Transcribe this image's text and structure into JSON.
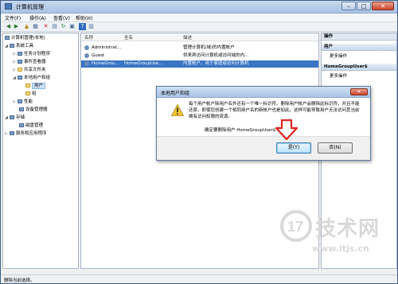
{
  "window": {
    "title": "计算机管理",
    "min": "–",
    "max": "□",
    "close": "✕"
  },
  "menu": [
    "文件(F)",
    "操作(A)",
    "查看(V)",
    "帮助(H)"
  ],
  "toolbar": {
    "icons": [
      "back-icon",
      "forward-icon",
      "up-icon",
      "show-tree-icon",
      "delete-icon",
      "properties-icon",
      "refresh-icon",
      "export-icon",
      "help-icon",
      "help-topics-icon"
    ]
  },
  "tree": {
    "root": "计算机管理(本地)",
    "system_tools": "系统工具",
    "task_scheduler": "任务计划程序",
    "event_viewer": "事件查看器",
    "shared_folders": "共享文件夹",
    "local_users_groups": "本地用户和组",
    "users": "用户",
    "groups": "组",
    "performance": "性能",
    "device_manager": "设备管理器",
    "storage": "存储",
    "disk_management": "磁盘管理",
    "services_apps": "服务和应用程序"
  },
  "list": {
    "headers": {
      "name": "名称",
      "fullname": "全名",
      "description": "描述"
    },
    "rows": [
      {
        "name": "Administrat...",
        "fullname": "",
        "description": "管理计算机(域)的内置帐户"
      },
      {
        "name": "Guest",
        "fullname": "",
        "description": "供来宾访问计算机或访问域的内..."
      },
      {
        "name": "HomeGrou...",
        "fullname": "HomeGroupUse...",
        "description": "内置帐户，用于家庭组访问计算机"
      }
    ]
  },
  "actions": {
    "title": "操作",
    "section1": "用户",
    "more1": "更多操作",
    "section2": "HomeGroupUser$",
    "more2": "更多操作"
  },
  "status": "删除当前选择。",
  "dialog": {
    "title": "本地用户和组",
    "close": "✕",
    "message": "每个用户帐户除用户名外还有一个唯一标识符。删除用户帐户会删除此标识符，并且不能还原，即使您创建一个相同用户名的新帐户也是如此。这样可能导致用户无法访问其当前拥有访问权限的资源。",
    "confirm": "确定要删除用户 HomeGroupUser$ 吗?",
    "yes": "是(Y)",
    "no": "否(N)"
  },
  "watermark": {
    "text": "技术网",
    "url": "www.itjs.cn",
    "digits": "17"
  },
  "colors": {
    "selection": "#3b75c4",
    "arrow": "#e02020"
  }
}
